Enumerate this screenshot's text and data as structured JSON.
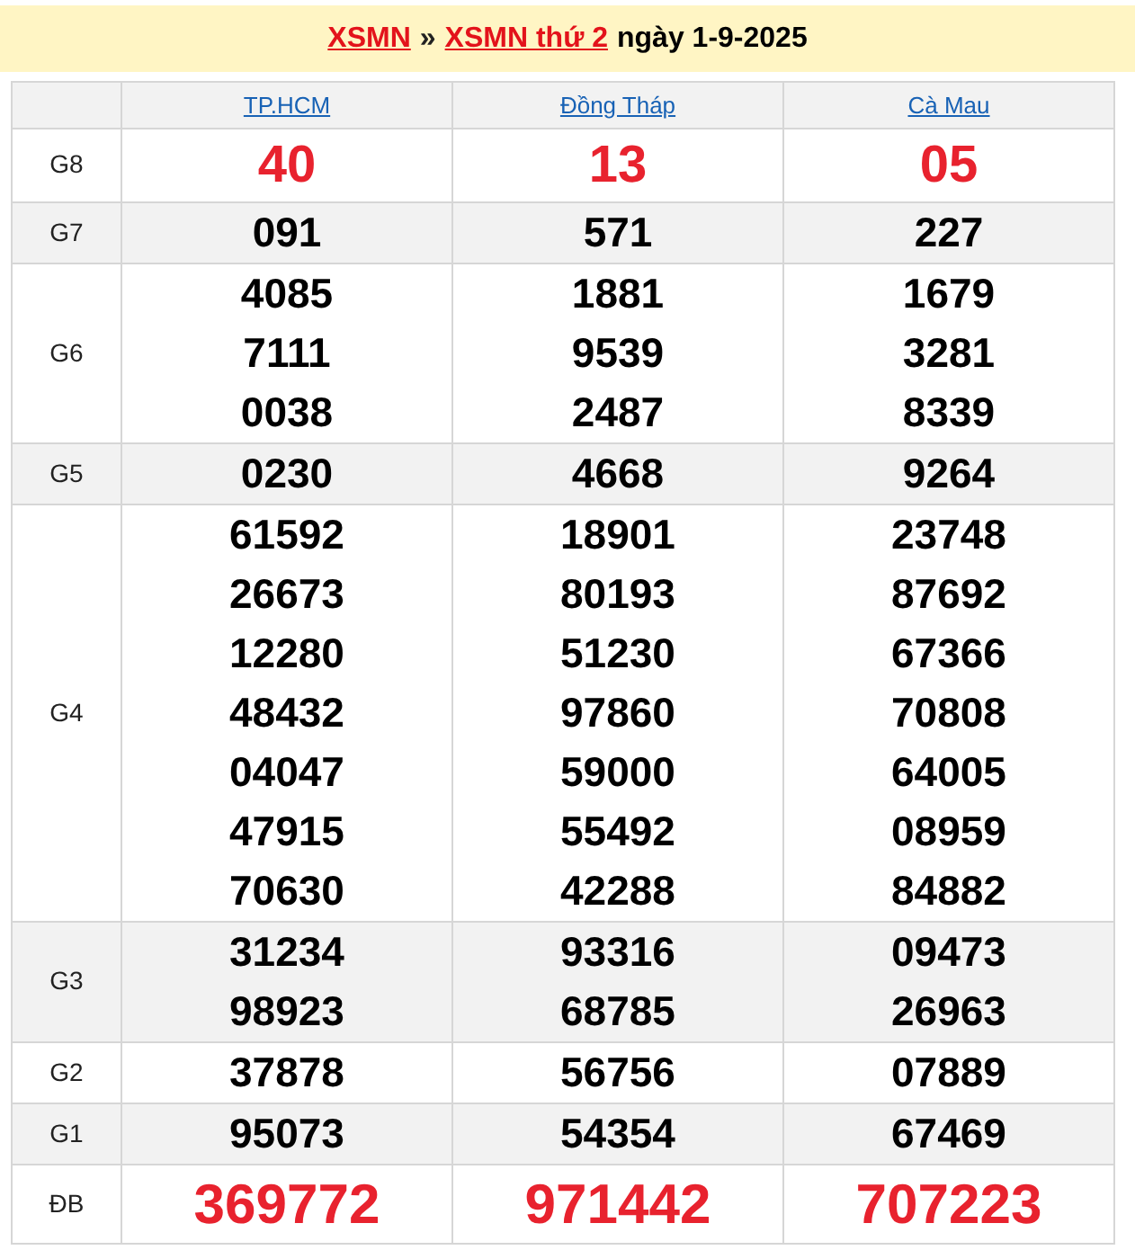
{
  "title": {
    "links": [
      "XSMN",
      "XSMN thứ 2"
    ],
    "separator": "»",
    "date_text": "ngày 1-9-2025"
  },
  "provinces": [
    "TP.HCM",
    "Đồng Tháp",
    "Cà Mau"
  ],
  "prizes": [
    {
      "label": "G8",
      "kind": "highlight",
      "results": [
        [
          "40"
        ],
        [
          "13"
        ],
        [
          "05"
        ]
      ]
    },
    {
      "label": "G7",
      "kind": "normal",
      "results": [
        [
          "091"
        ],
        [
          "571"
        ],
        [
          "227"
        ]
      ]
    },
    {
      "label": "G6",
      "kind": "normal",
      "results": [
        [
          "4085",
          "7111",
          "0038"
        ],
        [
          "1881",
          "9539",
          "2487"
        ],
        [
          "1679",
          "3281",
          "8339"
        ]
      ]
    },
    {
      "label": "G5",
      "kind": "normal",
      "results": [
        [
          "0230"
        ],
        [
          "4668"
        ],
        [
          "9264"
        ]
      ]
    },
    {
      "label": "G4",
      "kind": "normal",
      "results": [
        [
          "61592",
          "26673",
          "12280",
          "48432",
          "04047",
          "47915",
          "70630"
        ],
        [
          "18901",
          "80193",
          "51230",
          "97860",
          "59000",
          "55492",
          "42288"
        ],
        [
          "23748",
          "87692",
          "67366",
          "70808",
          "64005",
          "08959",
          "84882"
        ]
      ]
    },
    {
      "label": "G3",
      "kind": "normal",
      "results": [
        [
          "31234",
          "98923"
        ],
        [
          "93316",
          "68785"
        ],
        [
          "09473",
          "26963"
        ]
      ]
    },
    {
      "label": "G2",
      "kind": "normal",
      "results": [
        [
          "37878"
        ],
        [
          "56756"
        ],
        [
          "07889"
        ]
      ]
    },
    {
      "label": "G1",
      "kind": "normal",
      "results": [
        [
          "95073"
        ],
        [
          "54354"
        ],
        [
          "67469"
        ]
      ]
    },
    {
      "label": "ĐB",
      "kind": "highlight",
      "results": [
        [
          "369772"
        ],
        [
          "971442"
        ],
        [
          "707223"
        ]
      ]
    }
  ]
}
